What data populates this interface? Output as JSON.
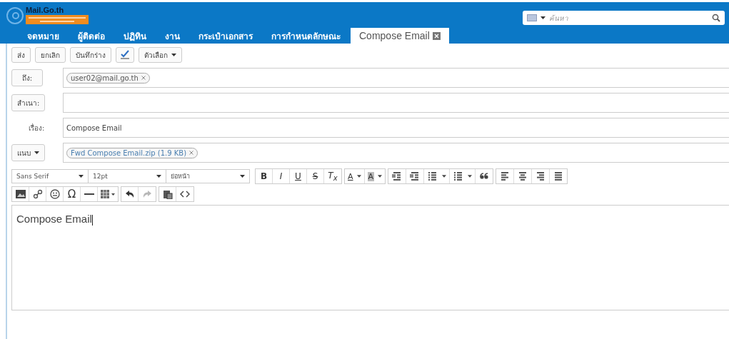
{
  "logo": {
    "title": "Mail.Go.th"
  },
  "search": {
    "placeholder": "ค้นหา"
  },
  "tabs": [
    {
      "label": "จดหมาย",
      "selected": false,
      "closable": false
    },
    {
      "label": "ผู้ติดต่อ",
      "selected": false,
      "closable": false
    },
    {
      "label": "ปฏิทิน",
      "selected": false,
      "closable": false
    },
    {
      "label": "งาน",
      "selected": false,
      "closable": false
    },
    {
      "label": "กระเป๋าเอกสาร",
      "selected": false,
      "closable": false
    },
    {
      "label": "การกำหนดลักษณะ",
      "selected": false,
      "closable": false
    },
    {
      "label": "Compose Email",
      "selected": true,
      "closable": true
    }
  ],
  "actions": [
    {
      "kind": "text",
      "label": "ส่ง"
    },
    {
      "kind": "text",
      "label": "ยกเลิก"
    },
    {
      "kind": "text",
      "label": "บันทึกร่าง"
    },
    {
      "kind": "spellcheck"
    },
    {
      "kind": "menu",
      "label": "ตัวเลือก"
    }
  ],
  "fields": [
    {
      "kind": "button",
      "label": "ถึง:",
      "chips": [
        "user02@mail.go.th"
      ]
    },
    {
      "kind": "button",
      "label": "สำเนา:"
    },
    {
      "kind": "plain",
      "label": "เรื่อง:",
      "value": "Compose Email"
    },
    {
      "kind": "menu",
      "label": "แนบ",
      "attachments": [
        "Fwd Compose Email.zip (1.9 KB)"
      ]
    }
  ],
  "format_selects": [
    {
      "value": "Sans Serif"
    },
    {
      "value": "12pt"
    },
    {
      "value": "ย่อหน้า"
    }
  ],
  "format_tools": [
    [
      {
        "kind": "bold",
        "label": "B"
      },
      {
        "kind": "italic",
        "label": "I"
      },
      {
        "kind": "underline",
        "label": "U"
      },
      {
        "kind": "strike",
        "label": "S"
      },
      {
        "kind": "clear",
        "label": "T$_{x}$"
      }
    ],
    [
      {
        "kind": "color",
        "label": "A"
      },
      {
        "kind": "highlight",
        "label": "A"
      }
    ],
    [
      {
        "kind": "outdent"
      },
      {
        "kind": "indent"
      },
      {
        "kind": "bullets"
      },
      {
        "kind": "numbers"
      },
      {
        "kind": "quote"
      }
    ],
    [
      {
        "kind": "align-left"
      },
      {
        "kind": "align-center"
      },
      {
        "kind": "align-right"
      },
      {
        "kind": "justify"
      }
    ]
  ],
  "insert_tools": [
    [
      {
        "kind": "image",
        "disabled": false
      },
      {
        "kind": "link",
        "disabled": false
      },
      {
        "kind": "emoji",
        "disabled": false
      },
      {
        "kind": "text",
        "label": "Ω",
        "disabled": false
      },
      {
        "kind": "rule",
        "disabled": false
      },
      {
        "kind": "table",
        "disabled": false
      }
    ],
    [
      {
        "kind": "undo",
        "disabled": false
      },
      {
        "kind": "redo",
        "disabled": true
      }
    ],
    [
      {
        "kind": "paste",
        "disabled": false
      },
      {
        "kind": "code",
        "disabled": false
      }
    ]
  ],
  "editor": {
    "value": "Compose Email"
  }
}
